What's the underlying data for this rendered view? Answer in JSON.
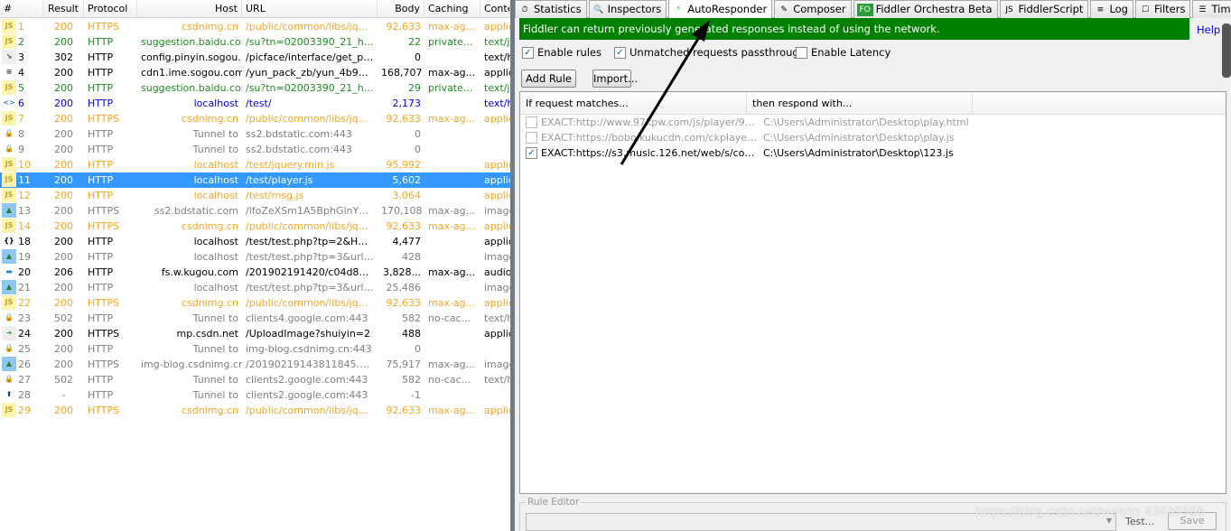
{
  "sessions": {
    "columns": [
      "#",
      "Result",
      "Protocol",
      "Host",
      "URL",
      "Body",
      "Caching",
      "Conte"
    ],
    "colors": {
      "orange": "#f5a623",
      "green": "#1e8c1e",
      "black": "#000000",
      "blue": "#0000ee",
      "gray": "#808080"
    },
    "rows": [
      {
        "id": "1",
        "result": "200",
        "protocol": "HTTPS",
        "host": "csdnimg.cn",
        "url": "/public/common/libs/jquer...",
        "body": "92,633",
        "caching": "max-ag...",
        "content": "applic",
        "color": "orange",
        "icon": "js"
      },
      {
        "id": "2",
        "result": "200",
        "protocol": "HTTP",
        "host": "suggestion.baidu.com",
        "url": "/su?tn=02003390_21_ha...",
        "body": "22",
        "caching": "private...",
        "content": "text/j",
        "color": "green",
        "icon": "js"
      },
      {
        "id": "3",
        "result": "302",
        "protocol": "HTTP",
        "host": "config.pinyin.sogou...",
        "url": "/picface/interface/get_pic...",
        "body": "0",
        "caching": "",
        "content": "text/h",
        "color": "black",
        "icon": "redirect"
      },
      {
        "id": "4",
        "result": "200",
        "protocol": "HTTP",
        "host": "cdn1.ime.sogou.com",
        "url": "/yun_pack_zb/yun_4b935...",
        "body": "168,707",
        "caching": "max-ag...",
        "content": "applic",
        "color": "black",
        "icon": "doc"
      },
      {
        "id": "5",
        "result": "200",
        "protocol": "HTTP",
        "host": "suggestion.baidu.com",
        "url": "/su?tn=02003390_21_ha...",
        "body": "29",
        "caching": "private...",
        "content": "text/j",
        "color": "green",
        "icon": "js"
      },
      {
        "id": "6",
        "result": "200",
        "protocol": "HTTP",
        "host": "localhost",
        "url": "/test/",
        "body": "2,173",
        "caching": "",
        "content": "text/h",
        "color": "blue",
        "icon": "html"
      },
      {
        "id": "7",
        "result": "200",
        "protocol": "HTTPS",
        "host": "csdnimg.cn",
        "url": "/public/common/libs/jquer...",
        "body": "92,633",
        "caching": "max-ag...",
        "content": "applic",
        "color": "orange",
        "icon": "js"
      },
      {
        "id": "8",
        "result": "200",
        "protocol": "HTTP",
        "host": "Tunnel to",
        "url": "ss2.bdstatic.com:443",
        "body": "0",
        "caching": "",
        "content": "",
        "color": "gray",
        "icon": "lock"
      },
      {
        "id": "9",
        "result": "200",
        "protocol": "HTTP",
        "host": "Tunnel to",
        "url": "ss2.bdstatic.com:443",
        "body": "0",
        "caching": "",
        "content": "",
        "color": "gray",
        "icon": "lock"
      },
      {
        "id": "10",
        "result": "200",
        "protocol": "HTTP",
        "host": "localhost",
        "url": "/test/jquery.min.js",
        "body": "95,992",
        "caching": "",
        "content": "applic",
        "color": "orange",
        "icon": "js"
      },
      {
        "id": "11",
        "result": "200",
        "protocol": "HTTP",
        "host": "localhost",
        "url": "/test/player.js",
        "body": "5,602",
        "caching": "",
        "content": "applic",
        "color": "orange",
        "icon": "js",
        "selected": true
      },
      {
        "id": "12",
        "result": "200",
        "protocol": "HTTP",
        "host": "localhost",
        "url": "/test/msg.js",
        "body": "3,064",
        "caching": "",
        "content": "applic",
        "color": "orange",
        "icon": "js"
      },
      {
        "id": "13",
        "result": "200",
        "protocol": "HTTPS",
        "host": "ss2.bdstatic.com",
        "url": "/lfoZeXSm1A5BphGlnYG/s...",
        "body": "170,108",
        "caching": "max-ag...",
        "content": "image",
        "color": "gray",
        "icon": "image"
      },
      {
        "id": "14",
        "result": "200",
        "protocol": "HTTPS",
        "host": "csdnimg.cn",
        "url": "/public/common/libs/jquer...",
        "body": "92,633",
        "caching": "max-ag...",
        "content": "applic",
        "color": "orange",
        "icon": "js"
      },
      {
        "id": "18",
        "result": "200",
        "protocol": "HTTP",
        "host": "localhost",
        "url": "/test/test.php?tp=2&Has...",
        "body": "4,477",
        "caching": "",
        "content": "applic",
        "color": "black",
        "icon": "json"
      },
      {
        "id": "19",
        "result": "200",
        "protocol": "HTTP",
        "host": "localhost",
        "url": "/test/test.php?tp=3&url=...",
        "body": "428",
        "caching": "",
        "content": "image",
        "color": "gray",
        "icon": "image"
      },
      {
        "id": "20",
        "result": "206",
        "protocol": "HTTP",
        "host": "fs.w.kugou.com",
        "url": "/201902191420/c04d86d...",
        "body": "3,828...",
        "caching": "max-ag...",
        "content": "audio,",
        "color": "black",
        "icon": "partial"
      },
      {
        "id": "21",
        "result": "200",
        "protocol": "HTTP",
        "host": "localhost",
        "url": "/test/test.php?tp=3&url=...",
        "body": "25,486",
        "caching": "",
        "content": "image",
        "color": "gray",
        "icon": "image"
      },
      {
        "id": "22",
        "result": "200",
        "protocol": "HTTPS",
        "host": "csdnimg.cn",
        "url": "/public/common/libs/jquer...",
        "body": "92,633",
        "caching": "max-ag...",
        "content": "applic",
        "color": "orange",
        "icon": "js"
      },
      {
        "id": "23",
        "result": "502",
        "protocol": "HTTP",
        "host": "Tunnel to",
        "url": "clients4.google.com:443",
        "body": "582",
        "caching": "no-cac...",
        "content": "text/h",
        "color": "gray",
        "icon": "lock"
      },
      {
        "id": "24",
        "result": "200",
        "protocol": "HTTPS",
        "host": "mp.csdn.net",
        "url": "/UploadImage?shuiyin=2",
        "body": "488",
        "caching": "",
        "content": "applic",
        "color": "black",
        "icon": "post"
      },
      {
        "id": "25",
        "result": "200",
        "protocol": "HTTP",
        "host": "Tunnel to",
        "url": "img-blog.csdnimg.cn:443",
        "body": "0",
        "caching": "",
        "content": "",
        "color": "gray",
        "icon": "lock"
      },
      {
        "id": "26",
        "result": "200",
        "protocol": "HTTPS",
        "host": "img-blog.csdnimg.cn",
        "url": "/20190219143811845.pn...",
        "body": "75,917",
        "caching": "max-ag...",
        "content": "image",
        "color": "gray",
        "icon": "image"
      },
      {
        "id": "27",
        "result": "502",
        "protocol": "HTTP",
        "host": "Tunnel to",
        "url": "clients2.google.com:443",
        "body": "582",
        "caching": "no-cac...",
        "content": "text/h",
        "color": "gray",
        "icon": "lock"
      },
      {
        "id": "28",
        "result": "-",
        "protocol": "HTTP",
        "host": "Tunnel to",
        "url": "clients2.google.com:443",
        "body": "-1",
        "caching": "",
        "content": "",
        "color": "gray",
        "icon": "upload-arrow"
      },
      {
        "id": "29",
        "result": "200",
        "protocol": "HTTPS",
        "host": "csdnimg.cn",
        "url": "/public/common/libs/jquer...",
        "body": "92,633",
        "caching": "max-ag...",
        "content": "applic",
        "color": "orange",
        "icon": "js"
      }
    ]
  },
  "tabs": [
    {
      "label": "Statistics",
      "icon": "stopwatch"
    },
    {
      "label": "Inspectors",
      "icon": "magnifier"
    },
    {
      "label": "AutoResponder",
      "icon": "lightning",
      "active": true
    },
    {
      "label": "Composer",
      "icon": "pencil"
    },
    {
      "label": "Fiddler Orchestra Beta",
      "icon": "fo"
    },
    {
      "label": "FiddlerScript",
      "icon": "script"
    },
    {
      "label": "Log",
      "icon": "log"
    },
    {
      "label": "Filters",
      "icon": "filter"
    },
    {
      "label": "Timeline",
      "icon": "timeline"
    }
  ],
  "autoresponder": {
    "banner": "Fiddler can return previously generated responses instead of using the network.",
    "banner_color": "#008000",
    "help": "Help",
    "enable_rules": {
      "label": "Enable rules",
      "checked": true
    },
    "passthrough": {
      "label": "Unmatched requests passthrough",
      "checked": true
    },
    "latency": {
      "label": "Enable Latency",
      "checked": false
    },
    "add_rule": "Add Rule",
    "import": "Import...",
    "col_match": "If request matches...",
    "col_respond": "then respond with...",
    "rules": [
      {
        "match": "EXACT:http://www.97kpw.com/js/player/97...",
        "respond": "C:\\Users\\Administrator\\Desktop\\play.html",
        "checked": false
      },
      {
        "match": "EXACT:https://bobo.kukucdn.com/ckplayerx...",
        "respond": "C:\\Users\\Administrator\\Desktop\\play.js",
        "checked": false
      },
      {
        "match": "EXACT:https://s3.music.126.net/web/s/core...",
        "respond": "C:\\Users\\Administrator\\Desktop\\123.js",
        "checked": true
      }
    ],
    "rule_editor": "Rule Editor",
    "test": "Test...",
    "save": "Save"
  },
  "watermark": "https://blog.csdn.net/weixin_43999566"
}
